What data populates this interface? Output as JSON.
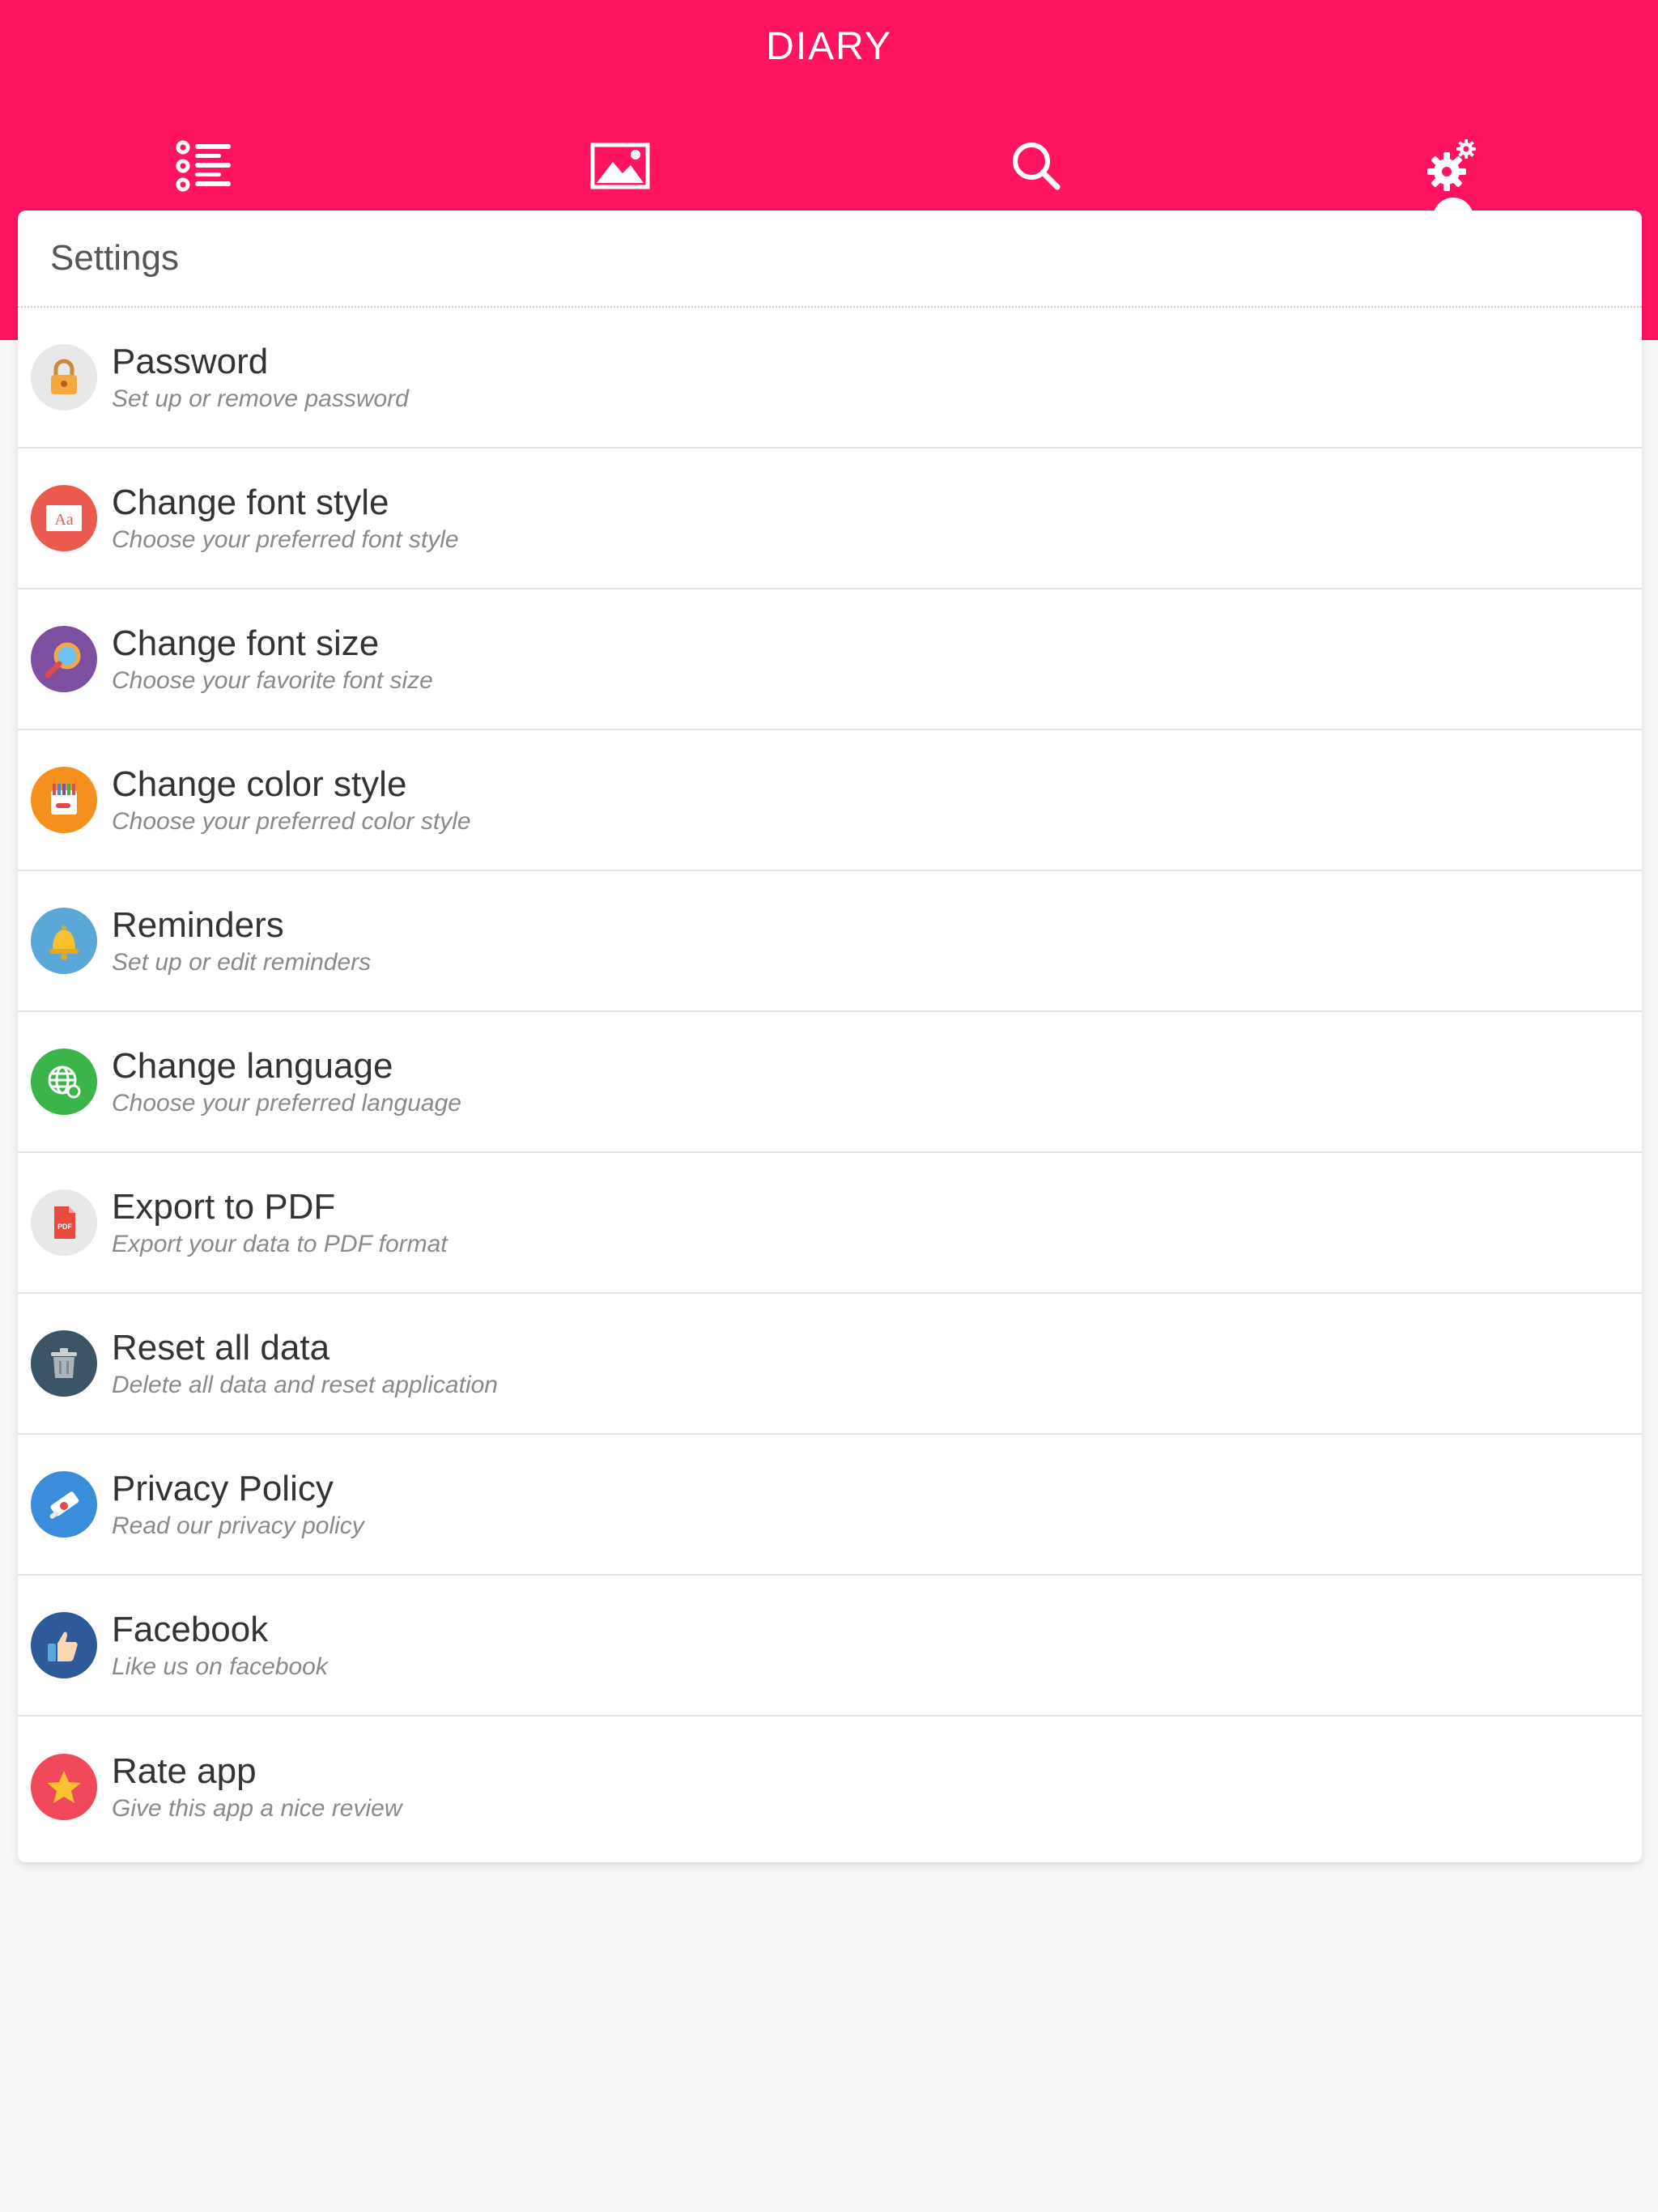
{
  "app": {
    "title": "DIARY",
    "accent_color": "#ff1460"
  },
  "tabs": [
    {
      "icon": "list-icon",
      "active": false
    },
    {
      "icon": "image-icon",
      "active": false
    },
    {
      "icon": "search-icon",
      "active": false
    },
    {
      "icon": "gears-icon",
      "active": true
    }
  ],
  "settings": {
    "title": "Settings",
    "items": [
      {
        "title": "Password",
        "subtitle": "Set up or remove password",
        "icon": "lock-icon",
        "icon_color": "#e8e8e8"
      },
      {
        "title": "Change font style",
        "subtitle": "Choose your preferred font style",
        "icon": "font-style-icon",
        "icon_color": "#ea5a4e"
      },
      {
        "title": "Change font size",
        "subtitle": "Choose your favorite font size",
        "icon": "magnifier-icon",
        "icon_color": "#7d4fa0"
      },
      {
        "title": "Change color style",
        "subtitle": "Choose your preferred color style",
        "icon": "palette-icon",
        "icon_color": "#f3901e"
      },
      {
        "title": "Reminders",
        "subtitle": "Set up or edit reminders",
        "icon": "bell-icon",
        "icon_color": "#5aa7d8"
      },
      {
        "title": "Change language",
        "subtitle": "Choose your preferred language",
        "icon": "globe-icon",
        "icon_color": "#3bb54a"
      },
      {
        "title": "Export to PDF",
        "subtitle": "Export your data to PDF format",
        "icon": "pdf-icon",
        "icon_color": "#e8e8e8"
      },
      {
        "title": "Reset all data",
        "subtitle": "Delete all data and reset application",
        "icon": "trash-icon",
        "icon_color": "#3c5566"
      },
      {
        "title": "Privacy Policy",
        "subtitle": "Read our privacy policy",
        "icon": "scroll-icon",
        "icon_color": "#3a8ddb"
      },
      {
        "title": "Facebook",
        "subtitle": "Like us on facebook",
        "icon": "thumbs-up-icon",
        "icon_color": "#2f5a9a"
      },
      {
        "title": "Rate app",
        "subtitle": "Give this app a nice review",
        "icon": "star-icon",
        "icon_color": "#f0475b"
      }
    ]
  }
}
